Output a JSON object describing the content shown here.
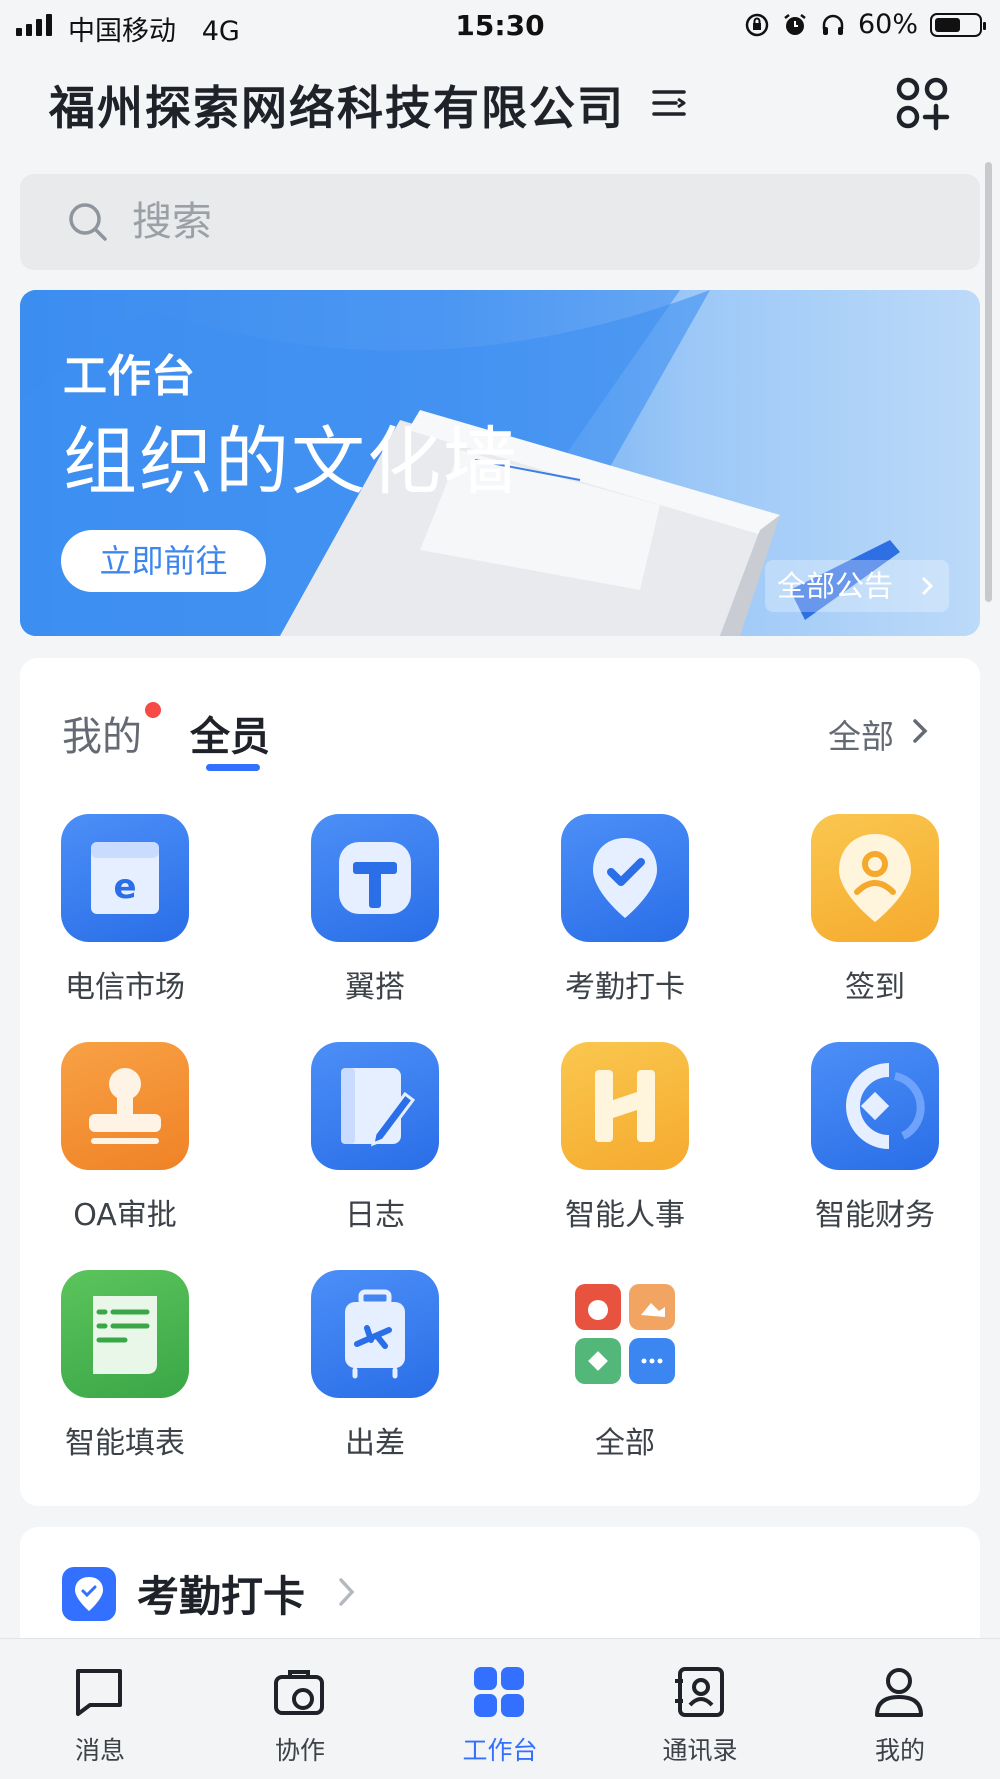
{
  "status_bar": {
    "carrier": "中国移动",
    "network": "4G",
    "time": "15:30",
    "battery_text": "60%",
    "battery_level": 0.6
  },
  "header": {
    "company_name": "福州探索网络科技有限公司",
    "switch_icon": "switch-org-icon",
    "add_icon": "add-app-icon"
  },
  "search": {
    "placeholder": "搜索"
  },
  "banner": {
    "subtitle": "工作台",
    "title": "组织的文化墙",
    "button": "立即前往",
    "all_notices": "全部公告"
  },
  "apps_card": {
    "tabs": [
      {
        "label": "我的",
        "has_dot": true
      },
      {
        "label": "全员",
        "active": true
      }
    ],
    "see_all": "全部",
    "apps": [
      {
        "label": "电信市场",
        "icon": "telecom-market-icon",
        "color": "#3b7ff1"
      },
      {
        "label": "翼搭",
        "icon": "yida-icon",
        "color": "#3b7ff1"
      },
      {
        "label": "考勤打卡",
        "icon": "attendance-icon",
        "color": "#3b7ff1"
      },
      {
        "label": "签到",
        "icon": "check-in-location-icon",
        "color": "#f7b63e"
      },
      {
        "label": "OA审批",
        "icon": "approval-stamp-icon",
        "color": "#f29035"
      },
      {
        "label": "日志",
        "icon": "journal-icon",
        "color": "#3b7ff1"
      },
      {
        "label": "智能人事",
        "icon": "smart-hr-icon",
        "color": "#f7b63e"
      },
      {
        "label": "智能财务",
        "icon": "smart-finance-icon",
        "color": "#3b7ff1"
      },
      {
        "label": "智能填表",
        "icon": "smart-form-icon",
        "color": "#4ab554"
      },
      {
        "label": "出差",
        "icon": "business-trip-icon",
        "color": "#3b7ff1"
      },
      {
        "label": "全部",
        "icon": "all-apps-icon",
        "color": "#ffffff"
      }
    ]
  },
  "attendance_card": {
    "title": "考勤打卡"
  },
  "tabbar": {
    "items": [
      {
        "label": "消息",
        "icon": "message-icon"
      },
      {
        "label": "协作",
        "icon": "collaboration-icon"
      },
      {
        "label": "工作台",
        "icon": "workbench-icon",
        "active": true
      },
      {
        "label": "通讯录",
        "icon": "contacts-icon"
      },
      {
        "label": "我的",
        "icon": "profile-icon"
      }
    ]
  },
  "colors": {
    "accent": "#3370ff",
    "badge": "#f54a45"
  }
}
